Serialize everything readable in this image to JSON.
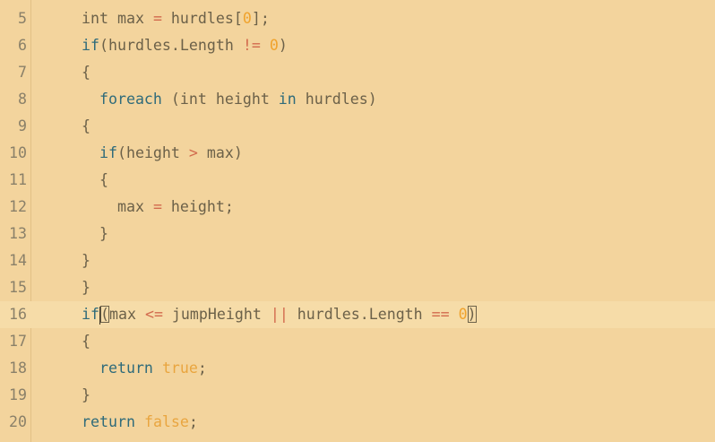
{
  "editor": {
    "theme_colors": {
      "background": "#f3d49d",
      "active_line": "#f6dca8",
      "text": "#6c6149",
      "keyword": "#2f6b7a",
      "operator": "#d26a4d",
      "number": "#f0a32d"
    },
    "active_line_number": "16",
    "lines": [
      {
        "num": "5",
        "tokens": [
          {
            "t": "int max ",
            "c": "plain"
          },
          {
            "t": "=",
            "c": "op"
          },
          {
            "t": " hurdles[",
            "c": "plain"
          },
          {
            "t": "0",
            "c": "num"
          },
          {
            "t": "];",
            "c": "plain"
          }
        ]
      },
      {
        "num": "6",
        "tokens": [
          {
            "t": "if",
            "c": "kw"
          },
          {
            "t": "(hurdles.Length ",
            "c": "plain"
          },
          {
            "t": "!=",
            "c": "op"
          },
          {
            "t": " ",
            "c": "plain"
          },
          {
            "t": "0",
            "c": "num"
          },
          {
            "t": ")",
            "c": "plain"
          }
        ]
      },
      {
        "num": "7",
        "tokens": [
          {
            "t": "{",
            "c": "plain"
          }
        ]
      },
      {
        "num": "8",
        "tokens": [
          {
            "t": "  ",
            "c": "plain"
          },
          {
            "t": "foreach",
            "c": "kw"
          },
          {
            "t": " (int height ",
            "c": "plain"
          },
          {
            "t": "in",
            "c": "kw"
          },
          {
            "t": " hurdles)",
            "c": "plain"
          }
        ]
      },
      {
        "num": "9",
        "tokens": [
          {
            "t": "{",
            "c": "plain"
          }
        ]
      },
      {
        "num": "10",
        "tokens": [
          {
            "t": "  ",
            "c": "plain"
          },
          {
            "t": "if",
            "c": "kw"
          },
          {
            "t": "(height ",
            "c": "plain"
          },
          {
            "t": ">",
            "c": "op"
          },
          {
            "t": " max)",
            "c": "plain"
          }
        ]
      },
      {
        "num": "11",
        "tokens": [
          {
            "t": "  {",
            "c": "plain"
          }
        ]
      },
      {
        "num": "12",
        "tokens": [
          {
            "t": "    max ",
            "c": "plain"
          },
          {
            "t": "=",
            "c": "op"
          },
          {
            "t": " height;",
            "c": "plain"
          }
        ]
      },
      {
        "num": "13",
        "tokens": [
          {
            "t": "  }",
            "c": "plain"
          }
        ]
      },
      {
        "num": "14",
        "tokens": [
          {
            "t": "}",
            "c": "plain"
          }
        ]
      },
      {
        "num": "15",
        "tokens": [
          {
            "t": "}",
            "c": "plain"
          }
        ]
      },
      {
        "num": "16",
        "tokens": [
          {
            "t": "if",
            "c": "kw"
          },
          {
            "t": "(",
            "c": "match"
          },
          {
            "t": "max ",
            "c": "plain"
          },
          {
            "t": "<=",
            "c": "op"
          },
          {
            "t": " jumpHeight ",
            "c": "plain"
          },
          {
            "t": "||",
            "c": "op"
          },
          {
            "t": " hurdles.Length ",
            "c": "plain"
          },
          {
            "t": "==",
            "c": "op"
          },
          {
            "t": " ",
            "c": "plain"
          },
          {
            "t": "0",
            "c": "num"
          },
          {
            "t": ")",
            "c": "match"
          }
        ]
      },
      {
        "num": "17",
        "tokens": [
          {
            "t": "{",
            "c": "plain"
          }
        ]
      },
      {
        "num": "18",
        "tokens": [
          {
            "t": "  ",
            "c": "plain"
          },
          {
            "t": "return",
            "c": "kw"
          },
          {
            "t": " ",
            "c": "plain"
          },
          {
            "t": "true",
            "c": "lit"
          },
          {
            "t": ";",
            "c": "plain"
          }
        ]
      },
      {
        "num": "19",
        "tokens": [
          {
            "t": "}",
            "c": "plain"
          }
        ]
      },
      {
        "num": "20",
        "tokens": [
          {
            "t": "return",
            "c": "kw"
          },
          {
            "t": " ",
            "c": "plain"
          },
          {
            "t": "false",
            "c": "lit"
          },
          {
            "t": ";",
            "c": "plain"
          }
        ]
      }
    ]
  }
}
